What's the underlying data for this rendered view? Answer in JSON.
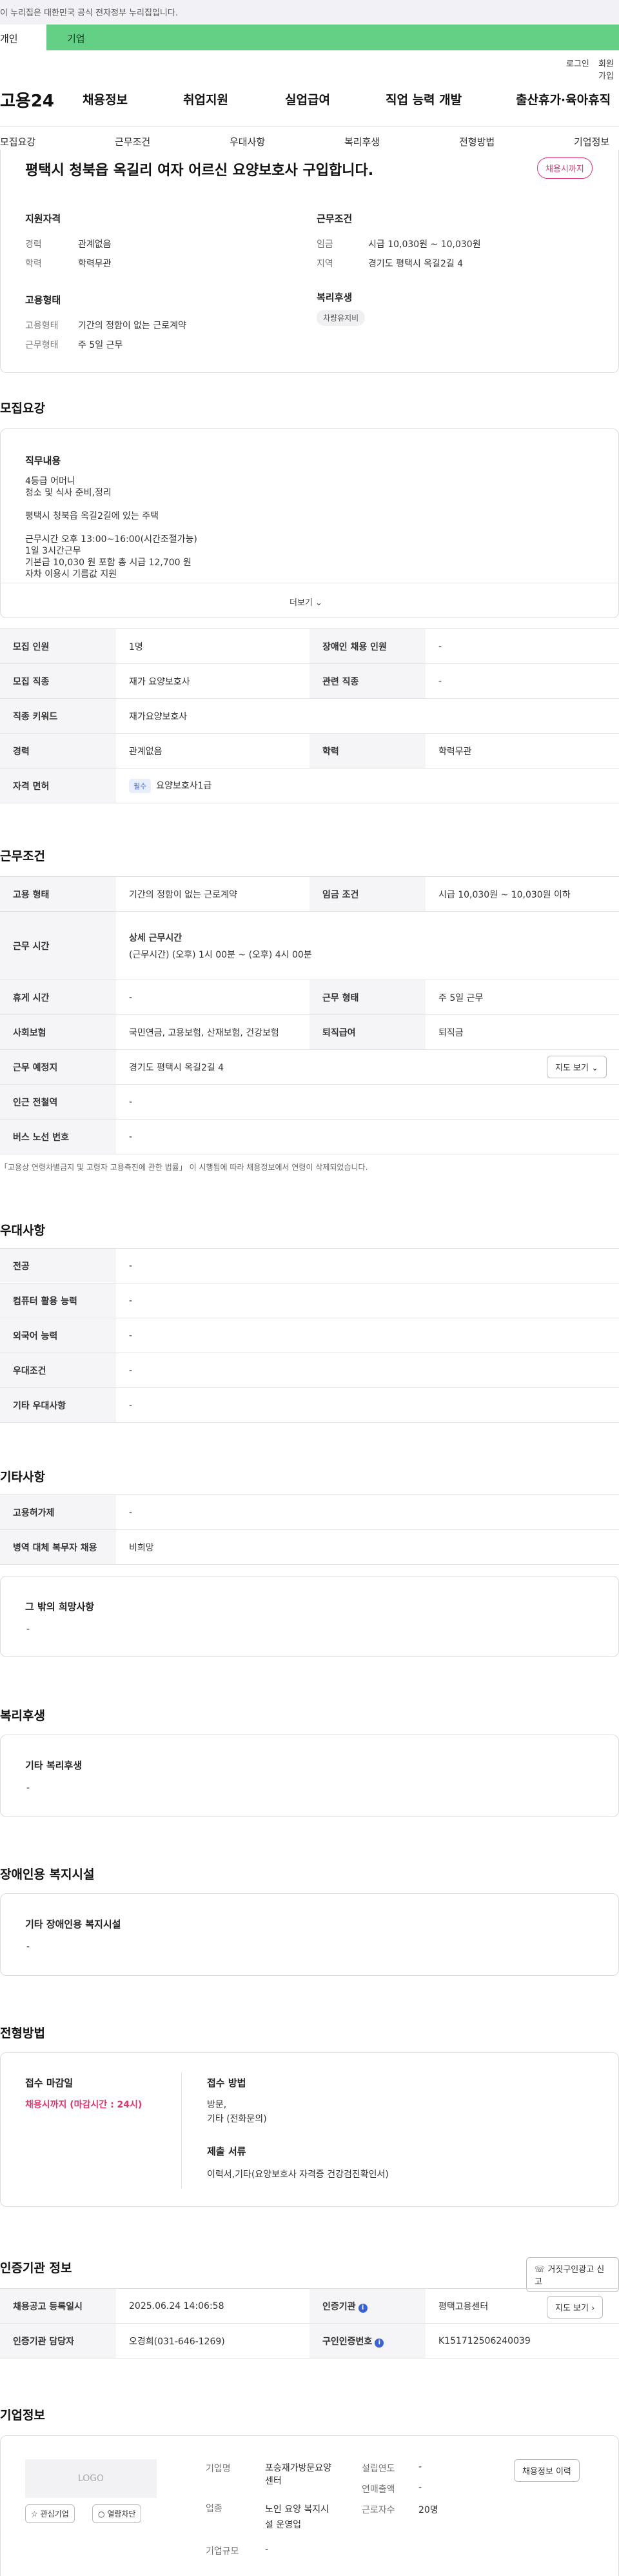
{
  "gov_banner": "이 누리집은 대한민국 공식 전자정부 누리집입니다.",
  "top_tabs": [
    "개인",
    "기업"
  ],
  "util_links": [
    "로그인",
    "회원가입"
  ],
  "logo": "고용24",
  "gnb": [
    "채용정보",
    "취업지원",
    "실업급여",
    "직업 능력 개발",
    "출산휴가·육아휴직"
  ],
  "sub_nav": [
    "모집요강",
    "근무조건",
    "우대사항",
    "복리후생",
    "전형방법",
    "기업정보"
  ],
  "summary": {
    "title": "평택시 청북읍 옥길리 여자 어르신 요양보호사 구입합니다.",
    "status": "채용시까지",
    "qual_title": "지원자격",
    "career_label": "경력",
    "career_value": "관계없음",
    "edu_label": "학력",
    "edu_value": "학력무관",
    "cond_title": "근무조건",
    "wage_label": "임금",
    "wage_value": "시급 10,030원 ~ 10,030원",
    "region_label": "지역",
    "region_value": "경기도 평택시 옥길2길 4",
    "emp_title": "고용형태",
    "emp_type_label": "고용형태",
    "emp_type_value": "기간의 정함이 없는 근로계약",
    "work_label": "근무형태",
    "work_value": "주 5일 근무",
    "welfare_title": "복리후생",
    "welfare_chip": "차량유지비"
  },
  "recruit": {
    "section_title": "모집요강",
    "duty_title": "직무내용",
    "duty_lines": [
      "4등급 어머니",
      "청소 및 식사 준비,정리",
      "",
      "평택시 청북읍 옥길2길에 있는 주택",
      "",
      "근무시간 오후 13:00~16:00(시간조절가능)",
      "1일 3시간근무",
      "기본급 10,030 원 포함 총 시급 12,700 원",
      "자차 이용시 기름값 지원"
    ],
    "more": "더보기",
    "rows": [
      {
        "l1": "모집 인원",
        "v1": "1명",
        "l2": "장애인 채용 인원",
        "v2": "-"
      },
      {
        "l1": "모집 직종",
        "v1": "재가 요양보호사",
        "l2": "관련 직종",
        "v2": "-"
      },
      {
        "l1": "직종 키워드",
        "v1": "재가요양보호사"
      },
      {
        "l1": "경력",
        "v1": "관계없음",
        "l2": "학력",
        "v2": "학력무관"
      },
      {
        "l1": "자격 면허",
        "tag": "필수",
        "v1": "요양보호사1급"
      }
    ]
  },
  "conditions": {
    "section_title": "근무조건",
    "emp_type_label": "고용 형태",
    "emp_type_value": "기간의 정함이 없는 근로계약",
    "wage_label": "임금 조건",
    "wage_value": "시급 10,030원 ~ 10,030원 이하",
    "hours_label": "근무 시간",
    "hours_sub": "상세 근무시간",
    "hours_value": "(근무시간) (오후) 1시 00분 ~ (오후) 4시 00분",
    "break_label": "휴게 시간",
    "break_value": "-",
    "shape_label": "근무 형태",
    "shape_value": "주 5일 근무",
    "insurance_label": "사회보험",
    "insurance_value": "국민연금, 고용보험, 산재보험, 건강보험",
    "retire_label": "퇴직급여",
    "retire_value": "퇴직금",
    "place_label": "근무 예정지",
    "place_value": "경기도 평택시 옥길2길 4",
    "map_btn": "지도 보기",
    "subway_label": "인근 전철역",
    "subway_value": "-",
    "bus_label": "버스 노선 번호",
    "bus_value": "-",
    "note": "「고용상 연령차별금지 및 고령자 고용촉진에 관한 법률」 이 시행됨에 따라 채용정보에서 연령이 삭제되었습니다."
  },
  "preference": {
    "section_title": "우대사항",
    "rows": [
      {
        "label": "전공",
        "value": "-"
      },
      {
        "label": "컴퓨터 활용 능력",
        "value": "-"
      },
      {
        "label": "외국어 능력",
        "value": "-"
      },
      {
        "label": "우대조건",
        "value": "-"
      },
      {
        "label": "기타 우대사항",
        "value": "-"
      }
    ]
  },
  "etc": {
    "section_title": "기타사항",
    "rows": [
      {
        "label": "고용허가제",
        "value": "-"
      },
      {
        "label": "병역 대체 복무자 채용",
        "value": "비희망"
      }
    ],
    "wish_title": "그 밖의 희망사항",
    "wish_value": "-"
  },
  "welfare": {
    "section_title": "복리후생",
    "box_title": "기타 복리후생",
    "box_value": "-"
  },
  "disability": {
    "section_title": "장애인용 복지시설",
    "box_title": "기타 장애인용 복지시설",
    "box_value": "-"
  },
  "selection": {
    "section_title": "전형방법",
    "deadline_title": "접수 마감일",
    "deadline_value": "채용시까지 (마감시간 : 24시)",
    "method_title": "접수 방법",
    "method_lines": [
      "방문,",
      "기타 (전화문의)"
    ],
    "docs_title": "제출 서류",
    "docs_value": "이력서,기타(요양보호사 자격증 건강검진확인서)"
  },
  "agency": {
    "section_title": "인증기관 정보",
    "report_btn": "거짓구인광고 신고",
    "date_label": "채용공고 등록일시",
    "date_value": "2025.06.24 14:06:58",
    "org_label": "인증기관",
    "org_value": "평택고용센터",
    "manager_label": "인증기관 담당자",
    "manager_value": "오경희(031-646-1269)",
    "map_btn": "지도 보기",
    "cert_label": "구인인증번호",
    "cert_value": "K151712506240039"
  },
  "company": {
    "section_title": "기업정보",
    "logo_text": "LOGO",
    "fav_btn": "관심기업",
    "block_btn": "열람차단",
    "name_label": "기업명",
    "name_value_lines": [
      "포승재가방문요양",
      "센터"
    ],
    "industry_label": "업종",
    "industry_value_lines": [
      "노인 요양 복지시",
      "설 운영업"
    ],
    "size_label": "기업규모",
    "size_value": "-",
    "founded_label": "설립연도",
    "founded_value": "-",
    "revenue_label": "연매출액",
    "revenue_value": "-",
    "employees_label": "근로자수",
    "employees_value": "20명",
    "detail_btn": "채용정보 이력"
  }
}
